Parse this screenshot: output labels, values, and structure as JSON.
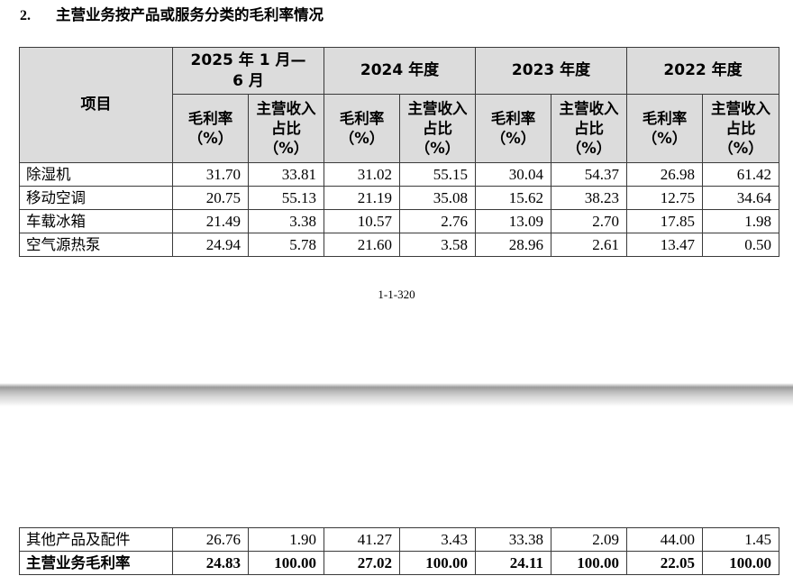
{
  "heading": {
    "number": "2.",
    "title": "主营业务按产品或服务分类的毛利率情况"
  },
  "table": {
    "item_header": "项目",
    "periods": [
      "2025 年 1 月—6 月",
      "2024 年度",
      "2023 年度",
      "2022 年度"
    ],
    "sub_headers": [
      "毛利率（%）",
      "主营收入占比（%）"
    ],
    "rows": [
      {
        "name": "除湿机",
        "values": [
          "31.70",
          "33.81",
          "31.02",
          "55.15",
          "30.04",
          "54.37",
          "26.98",
          "61.42"
        ]
      },
      {
        "name": "移动空调",
        "values": [
          "20.75",
          "55.13",
          "21.19",
          "35.08",
          "15.62",
          "38.23",
          "12.75",
          "34.64"
        ]
      },
      {
        "name": "车载冰箱",
        "values": [
          "21.49",
          "3.38",
          "10.57",
          "2.76",
          "13.09",
          "2.70",
          "17.85",
          "1.98"
        ]
      },
      {
        "name": "空气源热泵",
        "values": [
          "24.94",
          "5.78",
          "21.60",
          "3.58",
          "28.96",
          "2.61",
          "13.47",
          "0.50"
        ]
      }
    ],
    "continued_rows": [
      {
        "name": "其他产品及配件",
        "values": [
          "26.76",
          "1.90",
          "41.27",
          "3.43",
          "33.38",
          "2.09",
          "44.00",
          "1.45"
        ]
      },
      {
        "name": "主营业务毛利率",
        "values": [
          "24.83",
          "100.00",
          "27.02",
          "100.00",
          "24.11",
          "100.00",
          "22.05",
          "100.00"
        ],
        "bold": true
      }
    ]
  },
  "page_number": "1-1-320"
}
